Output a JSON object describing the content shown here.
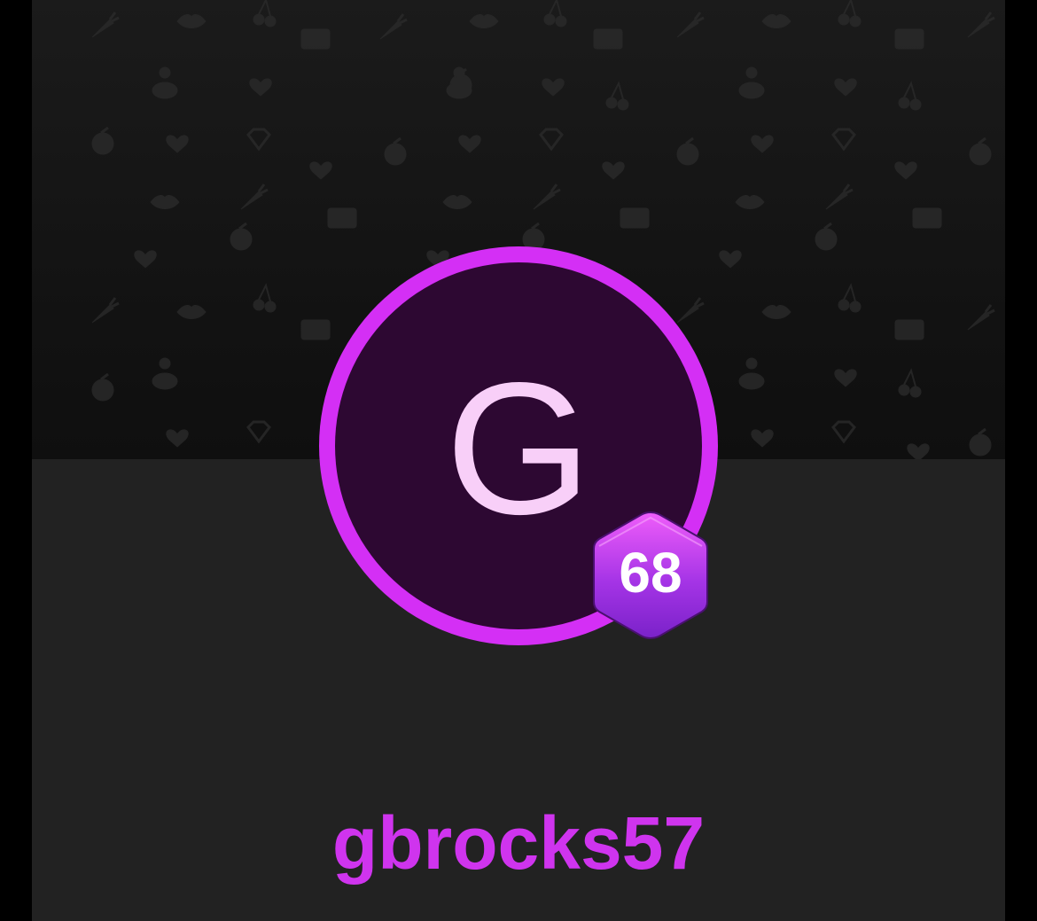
{
  "profile": {
    "avatar_initial": "G",
    "level": "68",
    "username": "gbrocks57"
  },
  "colors": {
    "accent": "#d42ff5",
    "avatar_background": "#2d0832",
    "avatar_letter": "#f8cff8",
    "badge_top": "#ef5dfa",
    "badge_bottom": "#7a22c9",
    "page_background": "#222222"
  },
  "cover": {
    "pattern_icons": [
      "heart-icon",
      "lips-icon",
      "cherry-icon",
      "envelope-icon",
      "carrot-icon",
      "diamond-icon",
      "peach-icon",
      "person-icon"
    ]
  }
}
